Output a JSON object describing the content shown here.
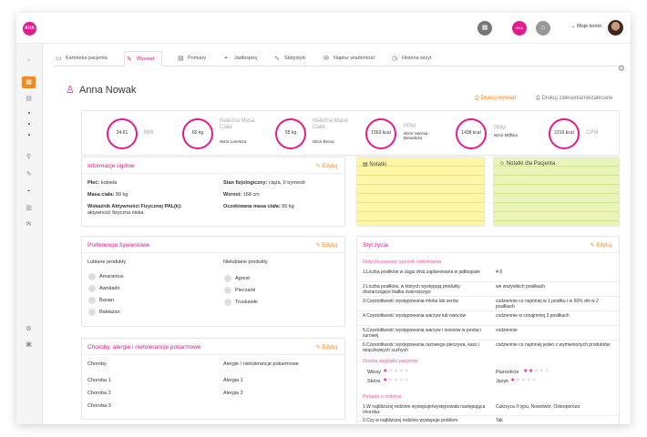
{
  "topbar": {
    "logo": "AHA",
    "account": "Moje konto",
    "icons": [
      "calendar-icon",
      "aha-icon",
      "cart-icon"
    ]
  },
  "sidebar": {
    "icons": [
      "collapse-arrow-icon",
      "grid-icon",
      "list-icon",
      "search-icon",
      "pencil-icon",
      "dish-icon",
      "table-icon",
      "mail-icon",
      "settings-icon",
      "building-icon"
    ]
  },
  "tabs": [
    {
      "label": "Kartoteka pacjenta",
      "icon": "folder-icon"
    },
    {
      "label": "Wywiad",
      "icon": "pin-icon"
    },
    {
      "label": "Pomiary",
      "icon": "scale-icon"
    },
    {
      "label": "Jadłospisy",
      "icon": "dish-icon"
    },
    {
      "label": "Statystyki",
      "icon": "chart-icon"
    },
    {
      "label": "Napisz wiadomość",
      "icon": "envelope-icon"
    },
    {
      "label": "Historia wizyt",
      "icon": "history-icon"
    }
  ],
  "patient": {
    "name": "Anna Nowak"
  },
  "actions": {
    "print_interview": "Drukuj wywiad",
    "print_recommendations": "Drukuj zalecenia/niezalecane"
  },
  "stats": [
    {
      "value": "24.61",
      "label": "BMI",
      "sub": ""
    },
    {
      "value": "60 kg",
      "label": "Należna Masa Ciała",
      "sub": "Wzór Lorentza"
    },
    {
      "value": "55 kg",
      "label": "Należna Masa Ciała",
      "sub": "Wzór Broca"
    },
    {
      "value": "1563 kcal",
      "label": "PPM",
      "sub": "Wzór Harrisa -Benedicta"
    },
    {
      "value": "1438 kcal",
      "label": "PPM",
      "sub": "Wzór Mifflina"
    },
    {
      "value": "2216 kcal",
      "label": "CPM",
      "sub": ""
    }
  ],
  "general": {
    "title": "Informacje ogólne",
    "edit": "Edytuj",
    "sex_label": "Płeć:",
    "sex": "kobieta",
    "weight_label": "Masa ciała:",
    "weight": "90 kg",
    "pal_label": "Wskaźnik Aktywności Fizycznej PAL(k):",
    "pal": "aktywność fizyczna niska",
    "physio_label": "Stan fizjologiczny:",
    "physio": "ciąża, II trymestr",
    "height_label": "Wzrost:",
    "height": "168 cm",
    "target_label": "Oczekiwana masa ciała:",
    "target": "55 kg"
  },
  "notes": {
    "title": "Notatki"
  },
  "patient_notes": {
    "title": "Notatki dla Pacjenta"
  },
  "food": {
    "title": "Preferencje żywieniowe",
    "edit": "Edytuj",
    "liked_header": "Lubiane produkty",
    "liked": [
      "Amarantus",
      "Awokado",
      "Banan",
      "Bakłażan"
    ],
    "disliked_header": "Nielubiane produkty",
    "disliked": [
      "Agrest",
      "Pieczarki",
      "Truskawki"
    ]
  },
  "diseases": {
    "title": "Choroby, alergie i nietolerancje pokarmowe",
    "edit": "Edytuj",
    "col1": "Choroby",
    "items1": [
      "Choroba 1",
      "Choroba 2",
      "Choroba 3"
    ],
    "col2": "Alergie / nietolerancje pokarmowe",
    "items2": [
      "Alergia 1",
      "Alergia 2"
    ]
  },
  "lifestyle": {
    "title": "Styl życia",
    "edit": "Edytuj",
    "section1": "Dotychczasowy sposób odżywiania",
    "rows": [
      {
        "q": "1.Liczba posiłków w ciągu dnia zaplanowana w jadłospisie",
        "a": "4-5"
      },
      {
        "q": "2.Liczba posiłków, w których występują produkty dostarczające białka zwierzęcego",
        "a": "we wszystkich posiłkach"
      },
      {
        "q": "3.Częstotliwość występowania mleka lub serów",
        "a": "codziennie co najmniej w 1 posiłku i w 50% dni w 2 posiłkach"
      },
      {
        "q": "4.Częstotliwość występowania warzyw lub owoców",
        "a": "codziennie w conajmniej 3 posiłkach"
      },
      {
        "q": "5.Częstotliwość występowania warzyw i owoców w postaci surowej",
        "a": "codziennie"
      },
      {
        "q": "6.Częstotliwość występowania razowego pieczywa, kasz i strączkowych suchych",
        "a": "codziennie co najmniej jeden z wymienionych produktów"
      }
    ],
    "section2": "Ocena wyglądu pacjenta",
    "ratings": [
      {
        "label": "Włosy",
        "value": 1,
        "max": 5
      },
      {
        "label": "Paznokcie",
        "value": 2,
        "max": 5
      },
      {
        "label": "Skóra",
        "value": 1,
        "max": 5
      },
      {
        "label": "Język",
        "value": 1,
        "max": 5
      }
    ],
    "section3": "Pytania o rodzinę",
    "family": [
      {
        "q": "1.W najbliższej rodzinie występuje/występowała następująca choroba:",
        "a": "Cukrzyca II typu, Nowotwór, Osteoporoza"
      },
      {
        "q": "2.Czy w najbliższej rodzinie występuje problem",
        "a": "Tak"
      }
    ]
  },
  "colors": {
    "accent": "#e31b8d",
    "orange": "#f08a24",
    "note_yellow": "#fff6a8",
    "note_green": "#e7f5b8"
  }
}
